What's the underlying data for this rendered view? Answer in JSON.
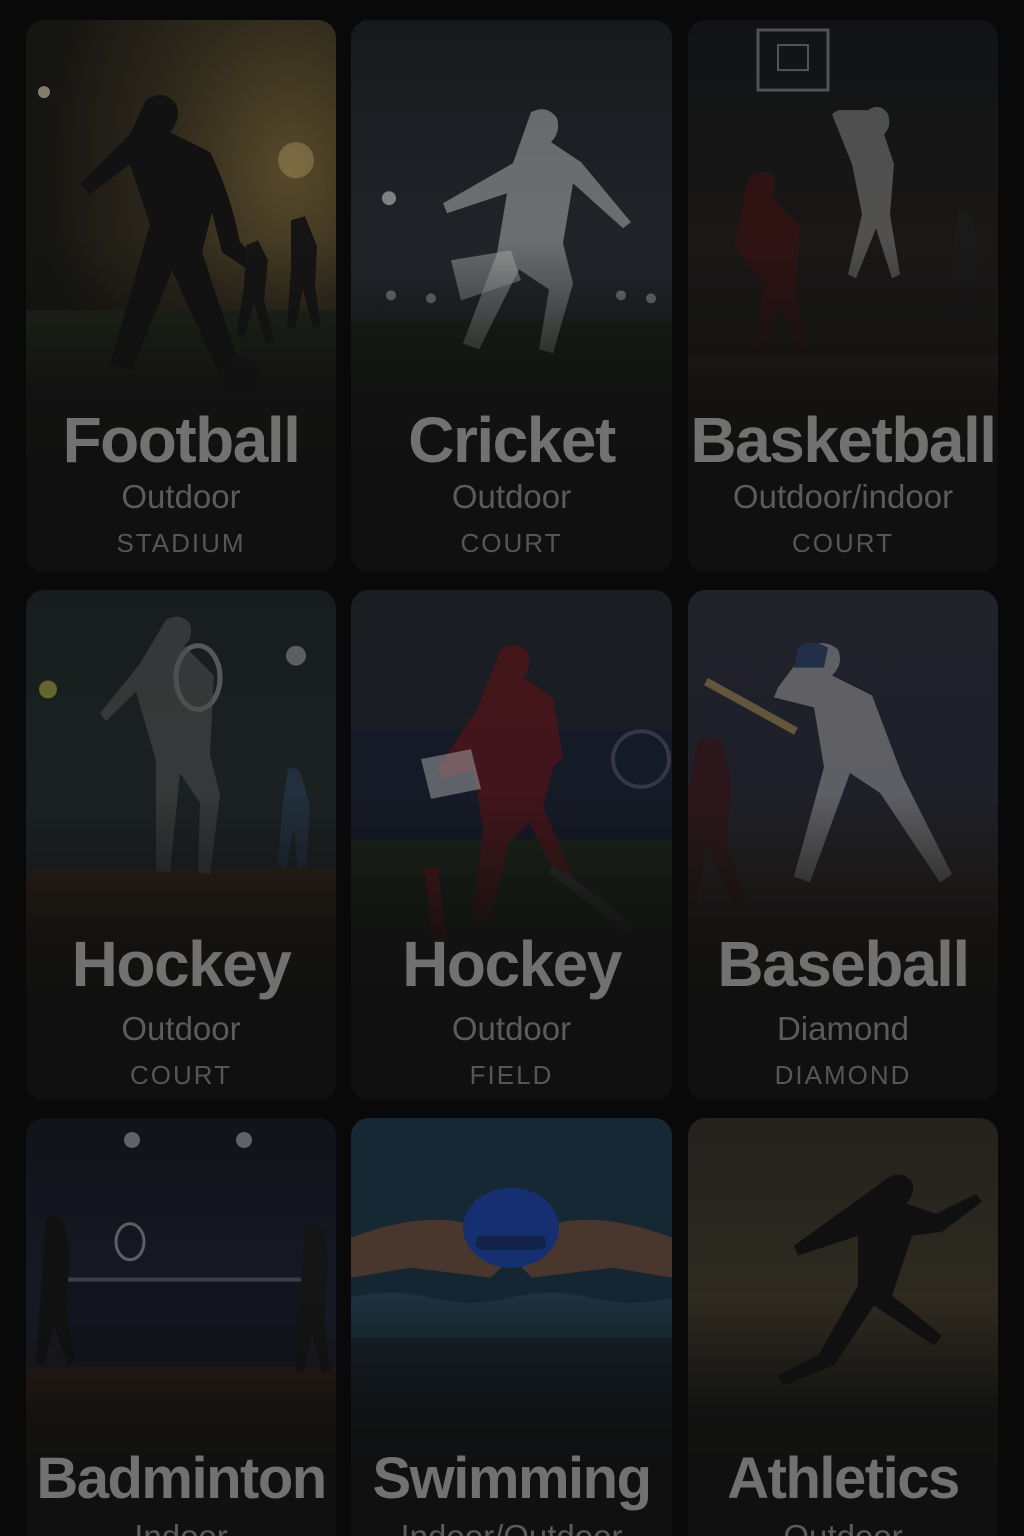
{
  "sports": [
    {
      "title": "Football",
      "type": "Outdoor",
      "venue": "STADIUM",
      "icon": "football-player-image",
      "tint": "#3a3322"
    },
    {
      "title": "Cricket",
      "type": "Outdoor",
      "venue": "COURT",
      "icon": "cricket-player-image",
      "tint": "#22262b"
    },
    {
      "title": "Basketball",
      "type": "Outdoor/indoor",
      "venue": "COURT",
      "icon": "basketball-players-image",
      "tint": "#2a221d"
    },
    {
      "title": "Hockey",
      "type": "Outdoor",
      "venue": "COURT",
      "icon": "tennis-player-image",
      "tint": "#232a2b"
    },
    {
      "title": "Hockey",
      "type": "Outdoor",
      "venue": "FIELD",
      "icon": "field-hockey-player-image",
      "tint": "#2b1d1f"
    },
    {
      "title": "Baseball",
      "type": "Diamond",
      "venue": "DIAMOND",
      "icon": "baseball-batter-image",
      "tint": "#252833"
    },
    {
      "title": "Badminton",
      "type": "Indoor",
      "venue": "",
      "icon": "badminton-players-image",
      "tint": "#1c2030"
    },
    {
      "title": "Swimming",
      "type": "Indoor/Outdoor",
      "venue": "",
      "icon": "swimmer-image",
      "tint": "#1d3340"
    },
    {
      "title": "Athletics",
      "type": "Outdoor",
      "venue": "",
      "icon": "sprinter-image",
      "tint": "#3a3528"
    }
  ]
}
